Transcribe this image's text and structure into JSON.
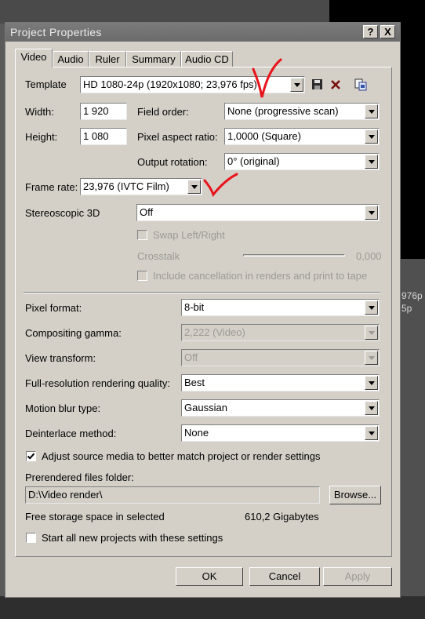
{
  "background": {
    "right_text_1": "976p",
    "right_text_2": "5p"
  },
  "dialog": {
    "title": "Project Properties",
    "help_button": "?",
    "close_button": "X",
    "tabs": [
      "Video",
      "Audio",
      "Ruler",
      "Summary",
      "Audio CD"
    ],
    "active_tab": "Video"
  },
  "video": {
    "template_label": "Template",
    "template_value": "HD 1080-24p (1920x1080; 23,976 fps)",
    "width_label": "Width:",
    "width_value": "1 920",
    "height_label": "Height:",
    "height_value": "1 080",
    "field_order_label": "Field order:",
    "field_order_value": "None (progressive scan)",
    "pixel_aspect_label": "Pixel aspect ratio:",
    "pixel_aspect_value": "1,0000 (Square)",
    "output_rotation_label": "Output rotation:",
    "output_rotation_value": "0° (original)",
    "frame_rate_label": "Frame rate:",
    "frame_rate_value": "23,976 (IVTC Film)",
    "stereo_label": "Stereoscopic 3D",
    "stereo_value": "Off",
    "swap_label": "Swap Left/Right",
    "crosstalk_label": "Crosstalk",
    "crosstalk_value": "0,000",
    "include_cancel_label": "Include cancellation in renders and print to tape",
    "pixel_format_label": "Pixel format:",
    "pixel_format_value": "8-bit",
    "compositing_gamma_label": "Compositing gamma:",
    "compositing_gamma_value": "2,222 (Video)",
    "view_transform_label": "View transform:",
    "view_transform_value": "Off",
    "full_res_label": "Full-resolution rendering quality:",
    "full_res_value": "Best",
    "motion_blur_label": "Motion blur type:",
    "motion_blur_value": "Gaussian",
    "deinterlace_label": "Deinterlace method:",
    "deinterlace_value": "None",
    "adjust_source_label": "Adjust source media to better match project or render settings",
    "adjust_source_checked": true,
    "prerendered_label": "Prerendered files folder:",
    "prerendered_value": "D:\\Video render\\",
    "browse_label": "Browse...",
    "free_storage_label": "Free storage space in selected",
    "free_storage_value": "610,2 Gigabytes",
    "start_all_label": "Start all new projects with these settings",
    "start_all_checked": false
  },
  "footer": {
    "ok_label": "OK",
    "cancel_label": "Cancel",
    "apply_label": "Apply"
  },
  "annotation_color": "#e8141b"
}
